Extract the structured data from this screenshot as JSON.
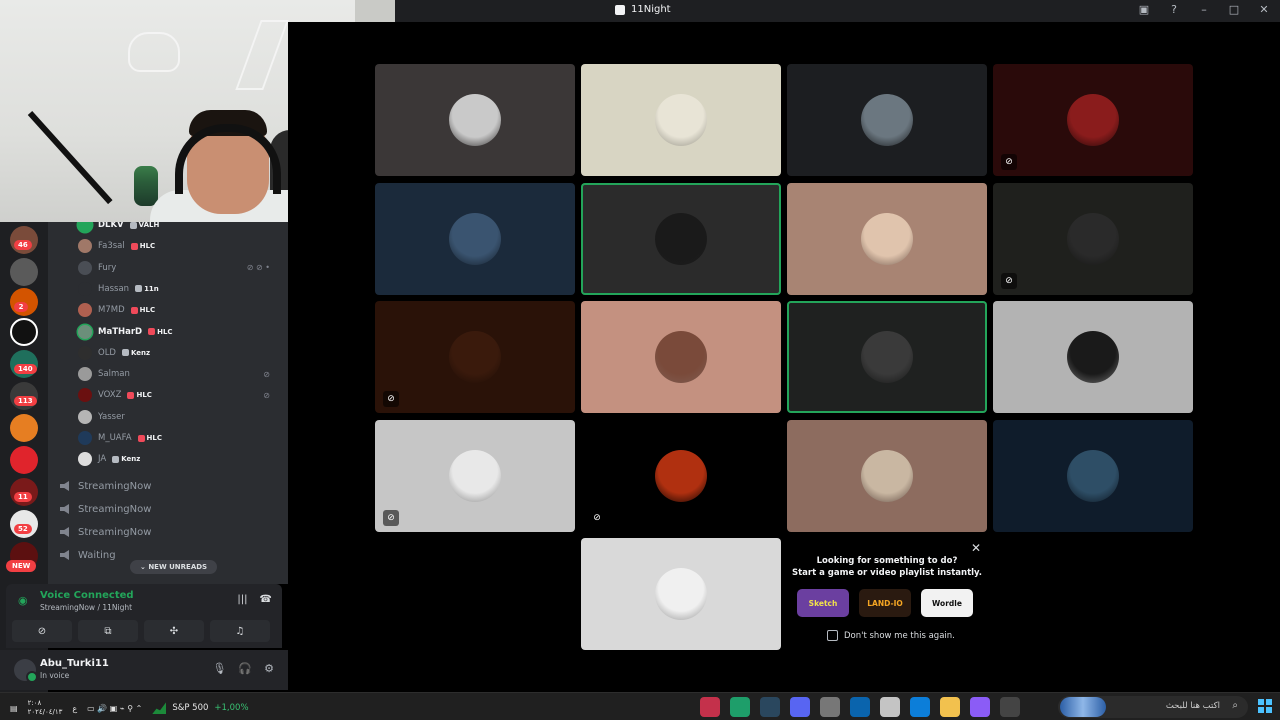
{
  "window": {
    "title": "11Night",
    "controls": [
      "monitor-icon",
      "help-icon",
      "minimize-icon",
      "maximize-icon",
      "close-icon"
    ]
  },
  "guild_rail": {
    "badges": [
      "46",
      "2",
      "140",
      "113",
      "11",
      "52"
    ],
    "new_label": "NEW"
  },
  "members": [
    {
      "name": "DLKV",
      "tag": "VALH",
      "color": "#23a55a",
      "active": true
    },
    {
      "name": "Fa3sal",
      "tag": "HLC",
      "color": "#a07868",
      "active": false
    },
    {
      "name": "Fury",
      "tag": "",
      "color": "#4a4e55",
      "active": false,
      "icons": "muted deafened live"
    },
    {
      "name": "Hassan",
      "tag": "11n",
      "color": "#2b2d31",
      "active": false
    },
    {
      "name": "M7MD",
      "tag": "HLC",
      "color": "#b06050",
      "active": false
    },
    {
      "name": "MaTHarD",
      "tag": "HLC",
      "color": "#6b8f7a",
      "active": true
    },
    {
      "name": "OLD",
      "tag": "Kenz",
      "color": "#2e2e2e",
      "active": false
    },
    {
      "name": "Salman",
      "tag": "",
      "color": "#9a9a9a",
      "active": false,
      "icons": "muted"
    },
    {
      "name": "VOXZ",
      "tag": "HLC",
      "color": "#6a1010",
      "active": false,
      "icons": "muted"
    },
    {
      "name": "Yasser",
      "tag": "",
      "color": "#b5b5b5",
      "active": false
    },
    {
      "name": "M_UAFA",
      "tag": "HLC",
      "color": "#1f3a5a",
      "active": false
    },
    {
      "name": "JA",
      "tag": "Kenz",
      "color": "#dddddd",
      "active": false
    }
  ],
  "voice_channels": [
    "StreamingNow",
    "StreamingNow",
    "StreamingNow",
    "Waiting"
  ],
  "new_unreads": "NEW UNREADS",
  "voice_panel": {
    "status": "Voice Connected",
    "location": "StreamingNow / 11Night"
  },
  "user_panel": {
    "username": "Abu_Turki11",
    "status": "In voice"
  },
  "tiles": [
    {
      "bg": "#3b3737",
      "av": "#c9c9c9",
      "speaking": false,
      "muted": false
    },
    {
      "bg": "#d8d5c3",
      "av": "#e8e4d6",
      "speaking": false,
      "muted": false
    },
    {
      "bg": "#1c1e21",
      "av": "#6b7780",
      "speaking": false,
      "muted": false
    },
    {
      "bg": "#2a0a0a",
      "av": "#8a1c1c",
      "speaking": false,
      "muted": true
    },
    {
      "bg": "#1b2a3b",
      "av": "#3a5470",
      "speaking": false,
      "muted": false
    },
    {
      "bg": "#2b2b2b",
      "av": "#1a1a1a",
      "speaking": true,
      "muted": false
    },
    {
      "bg": "#a88473",
      "av": "#e0c4ad",
      "speaking": false,
      "muted": false
    },
    {
      "bg": "#1f201d",
      "av": "#2a2a2a",
      "speaking": false,
      "muted": true
    },
    {
      "bg": "#2a1208",
      "av": "#3a1a0c",
      "speaking": false,
      "muted": true
    },
    {
      "bg": "#c49180",
      "av": "#7a4a3a",
      "speaking": false,
      "muted": false
    },
    {
      "bg": "#1f2120",
      "av": "#3a3a3a",
      "speaking": true,
      "muted": false
    },
    {
      "bg": "#b3b3b3",
      "av": "#1a1a1a",
      "speaking": false,
      "muted": false
    },
    {
      "bg": "#c6c6c6",
      "av": "#e8e8e8",
      "speaking": false,
      "muted": true
    },
    {
      "bg": "#000000",
      "av": "#b03010",
      "speaking": false,
      "muted": true
    },
    {
      "bg": "#8d6c5f",
      "av": "#c9b7a2",
      "speaking": false,
      "muted": false
    },
    {
      "bg": "#0f1c2b",
      "av": "#2e4e66",
      "speaking": false,
      "muted": false
    },
    {
      "bg": "#d9d9d9",
      "av": "#f0f0f0",
      "speaking": false,
      "muted": false
    }
  ],
  "activity": {
    "line1": "Looking for something to do?",
    "line2": "Start a game or video playlist instantly.",
    "games": [
      {
        "label": "Sketch",
        "bg": "#6b3fa0",
        "color": "#f2e34a"
      },
      {
        "label": "LAND-IO",
        "bg": "#2a1a10",
        "color": "#f5a623"
      },
      {
        "label": "Wordle",
        "bg": "#f2f2f2",
        "color": "#111111"
      }
    ],
    "dont_show": "Don't show me this again."
  },
  "taskbar": {
    "time": "۲:۰۸",
    "date": "٢٠٢٤/٠٤/١٣",
    "ticker_name": "S&P 500",
    "ticker_change": "+1,00%",
    "search_placeholder": "اكتب هنا للبحث",
    "apps": [
      "#c4314b",
      "#1e9e6a",
      "#2a475e",
      "#5865f2",
      "#777777",
      "#0a64ad",
      "#c4c4c4",
      "#0c7ed9",
      "#f2c14e",
      "#8b5cf6",
      "#444444"
    ]
  }
}
